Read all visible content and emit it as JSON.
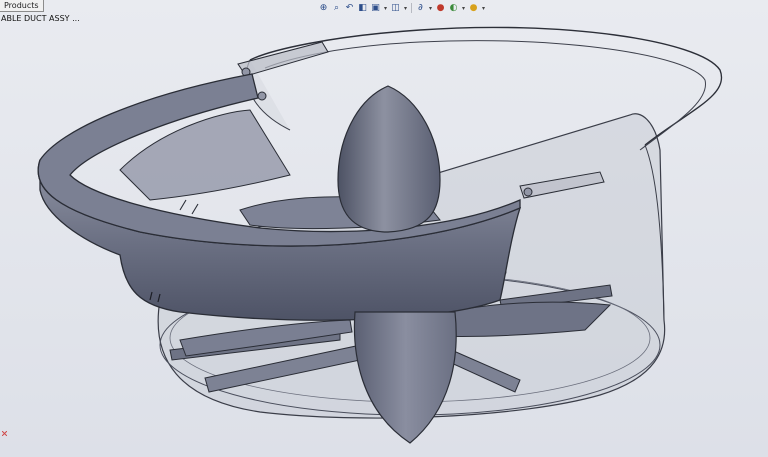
{
  "header": {
    "tab_label": "Products",
    "tree_item": "ABLE DUCT ASSY ..."
  },
  "toolbar": {
    "buttons": [
      {
        "name": "zoom-to-fit-icon",
        "glyph": "⊕"
      },
      {
        "name": "zoom-to-area-icon",
        "glyph": "⌕"
      },
      {
        "name": "previous-view-icon",
        "glyph": "↶"
      },
      {
        "name": "section-view-icon",
        "glyph": "◧"
      },
      {
        "name": "view-orientation-icon",
        "glyph": "▣"
      },
      {
        "name": "display-style-icon",
        "glyph": "◫"
      },
      {
        "name": "hide-show-icon",
        "glyph": "∂"
      },
      {
        "name": "edit-appearance-icon",
        "glyph": "●"
      },
      {
        "name": "apply-scene-icon",
        "glyph": "◐"
      },
      {
        "name": "view-settings-icon",
        "glyph": "●"
      }
    ]
  },
  "colors": {
    "background": "#e2e5ec",
    "model_surface": "#7c8295",
    "model_dark": "#4e5366",
    "edge": "#2a2d36",
    "glass": "#b9bcc6"
  }
}
